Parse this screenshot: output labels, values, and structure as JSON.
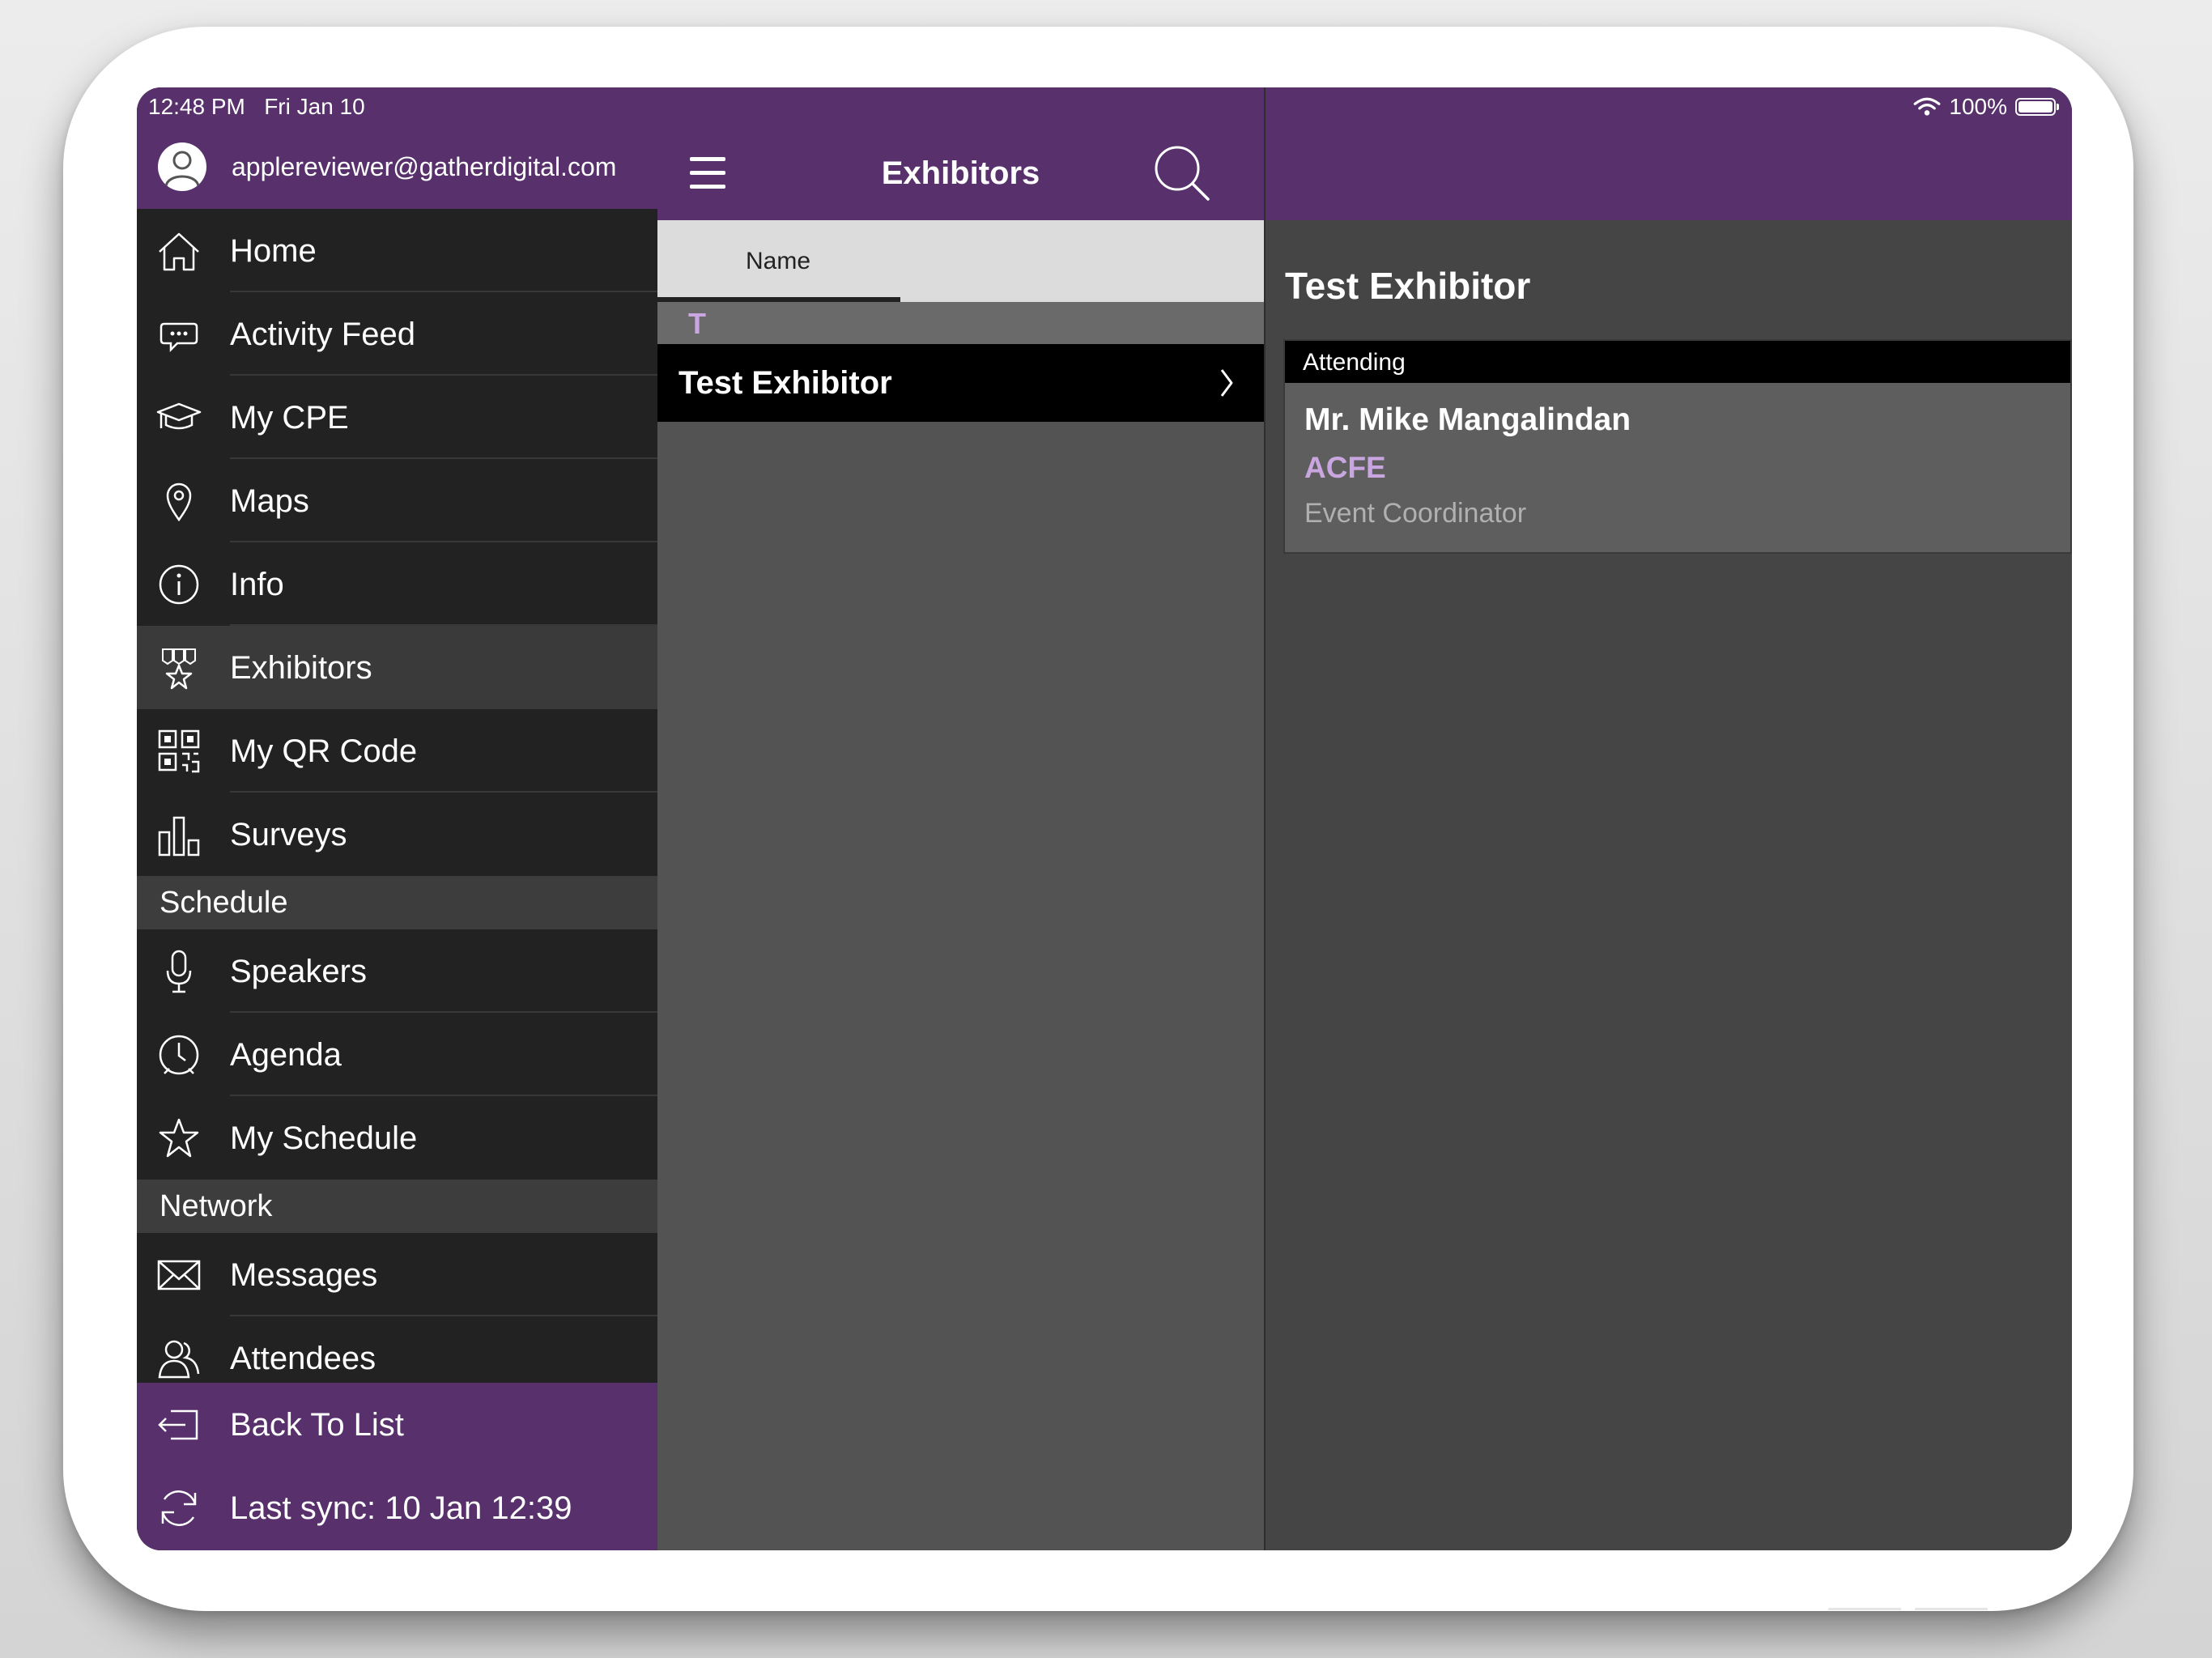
{
  "status_bar": {
    "time": "12:48 PM",
    "date": "Fri Jan 10",
    "battery": "100%",
    "icons": [
      "wifi-icon",
      "battery-icon"
    ]
  },
  "sidebar": {
    "user_email": "applereviewer@gatherdigital.com",
    "items": [
      {
        "label": "Home",
        "icon": "home-icon"
      },
      {
        "label": "Activity Feed",
        "icon": "chat-bubble-icon"
      },
      {
        "label": "My CPE",
        "icon": "graduation-cap-icon"
      },
      {
        "label": "Maps",
        "icon": "map-pin-icon"
      },
      {
        "label": "Info",
        "icon": "info-icon"
      },
      {
        "label": "Exhibitors",
        "icon": "exhibitor-star-icon",
        "selected": true
      },
      {
        "label": "My QR Code",
        "icon": "qr-code-icon"
      },
      {
        "label": "Surveys",
        "icon": "bar-chart-icon"
      }
    ],
    "schedule_header": "Schedule",
    "schedule_items": [
      {
        "label": "Speakers",
        "icon": "microphone-icon"
      },
      {
        "label": "Agenda",
        "icon": "clock-icon"
      },
      {
        "label": "My Schedule",
        "icon": "star-icon"
      }
    ],
    "network_header": "Network",
    "network_items": [
      {
        "label": "Messages",
        "icon": "envelope-icon"
      },
      {
        "label": "Attendees",
        "icon": "people-icon"
      }
    ],
    "footer": {
      "back_label": "Back To List",
      "sync_label": "Last sync:  10 Jan 12:39"
    }
  },
  "list_pane": {
    "title": "Exhibitors",
    "tab_label": "Name",
    "section_letter": "T",
    "rows": [
      {
        "label": "Test Exhibitor"
      }
    ]
  },
  "detail_pane": {
    "title": "Test Exhibitor",
    "card_header": "Attending",
    "person_name": "Mr. Mike Mangalindan",
    "person_org": "ACFE",
    "person_role": "Event Coordinator"
  },
  "colors": {
    "brand_purple": "#57306c",
    "accent_lavender": "#c9a6e0",
    "sidebar_bg": "#222222"
  }
}
